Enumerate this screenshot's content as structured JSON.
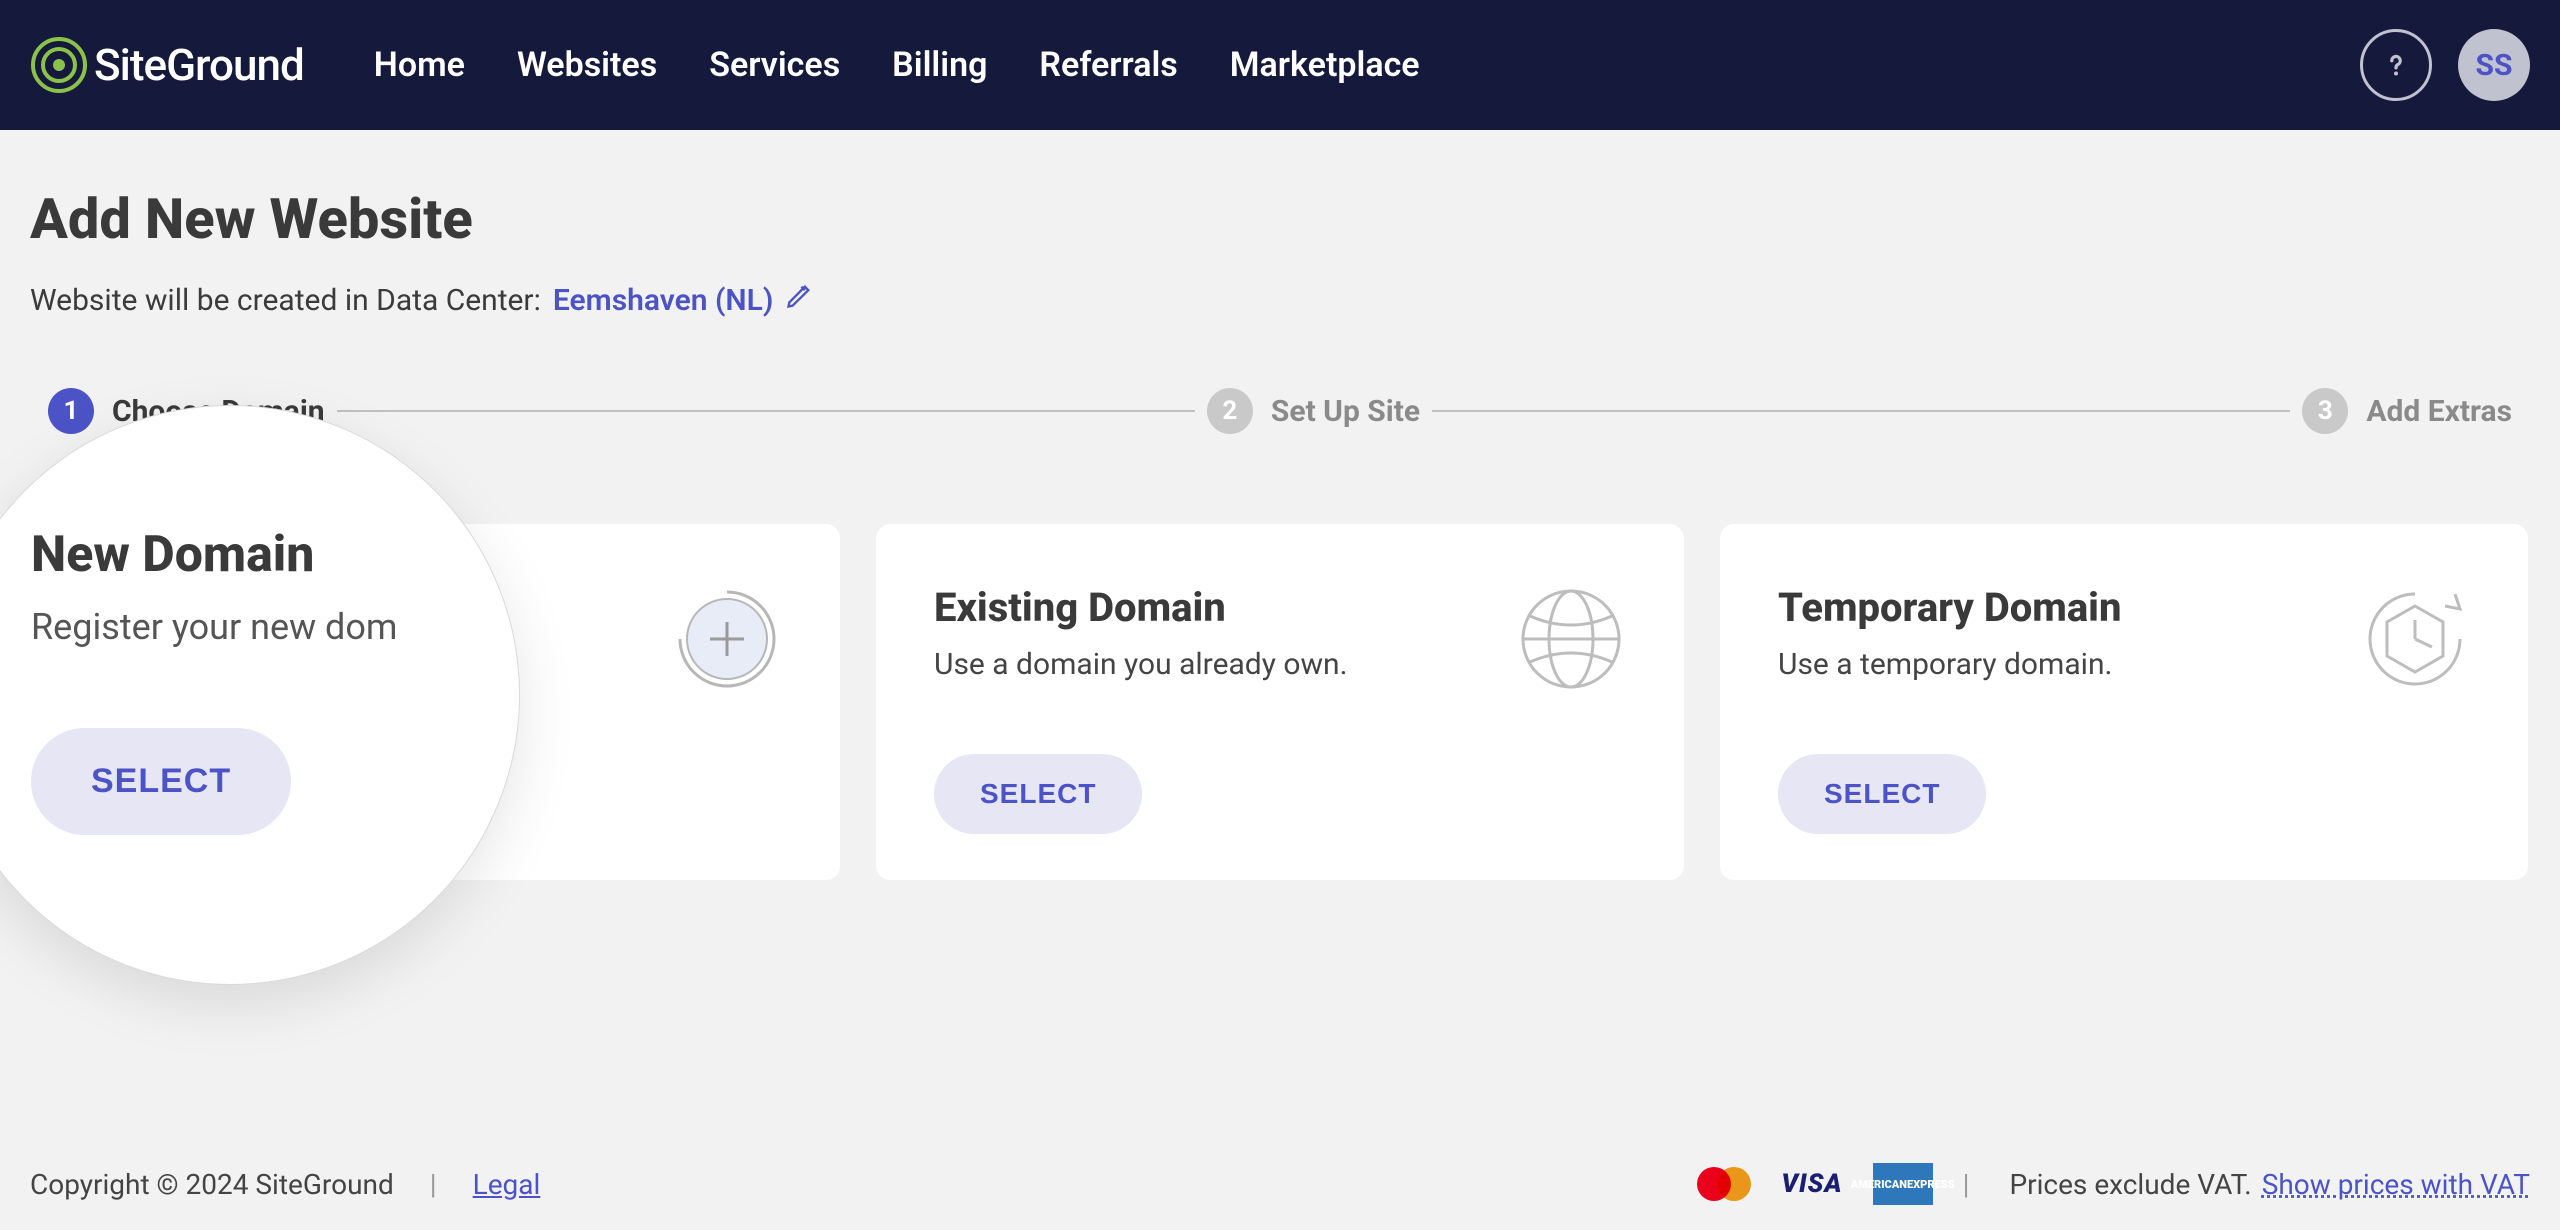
{
  "brand": "SiteGround",
  "nav": {
    "items": [
      "Home",
      "Websites",
      "Services",
      "Billing",
      "Referrals",
      "Marketplace"
    ]
  },
  "user": {
    "initials": "SS"
  },
  "page": {
    "title": "Add New Website",
    "datacenter_prefix": "Website will be created in Data Center:",
    "datacenter": "Eemshaven (NL)"
  },
  "steps": [
    {
      "num": "1",
      "label": "Choose Domain",
      "active": true
    },
    {
      "num": "2",
      "label": "Set Up Site",
      "active": false
    },
    {
      "num": "3",
      "label": "Add Extras",
      "active": false
    }
  ],
  "cards": {
    "new_domain": {
      "title": "New Domain",
      "sub": "Register your new domain.",
      "button": "SELECT"
    },
    "existing_domain": {
      "title": "Existing Domain",
      "sub": "Use a domain you already own.",
      "button": "SELECT"
    },
    "temporary_domain": {
      "title": "Temporary Domain",
      "sub": "Use a temporary domain.",
      "button": "SELECT"
    }
  },
  "magnifier": {
    "title": "New Domain",
    "sub": "Register your new dom",
    "button": "SELECT"
  },
  "footer": {
    "copyright": "Copyright © 2024 SiteGround",
    "legal": "Legal",
    "vat_text": "Prices exclude VAT.",
    "vat_link": "Show prices with VAT",
    "cards": {
      "visa": "VISA",
      "amex_l1": "AMERICAN",
      "amex_l2": "EXPRESS"
    }
  }
}
